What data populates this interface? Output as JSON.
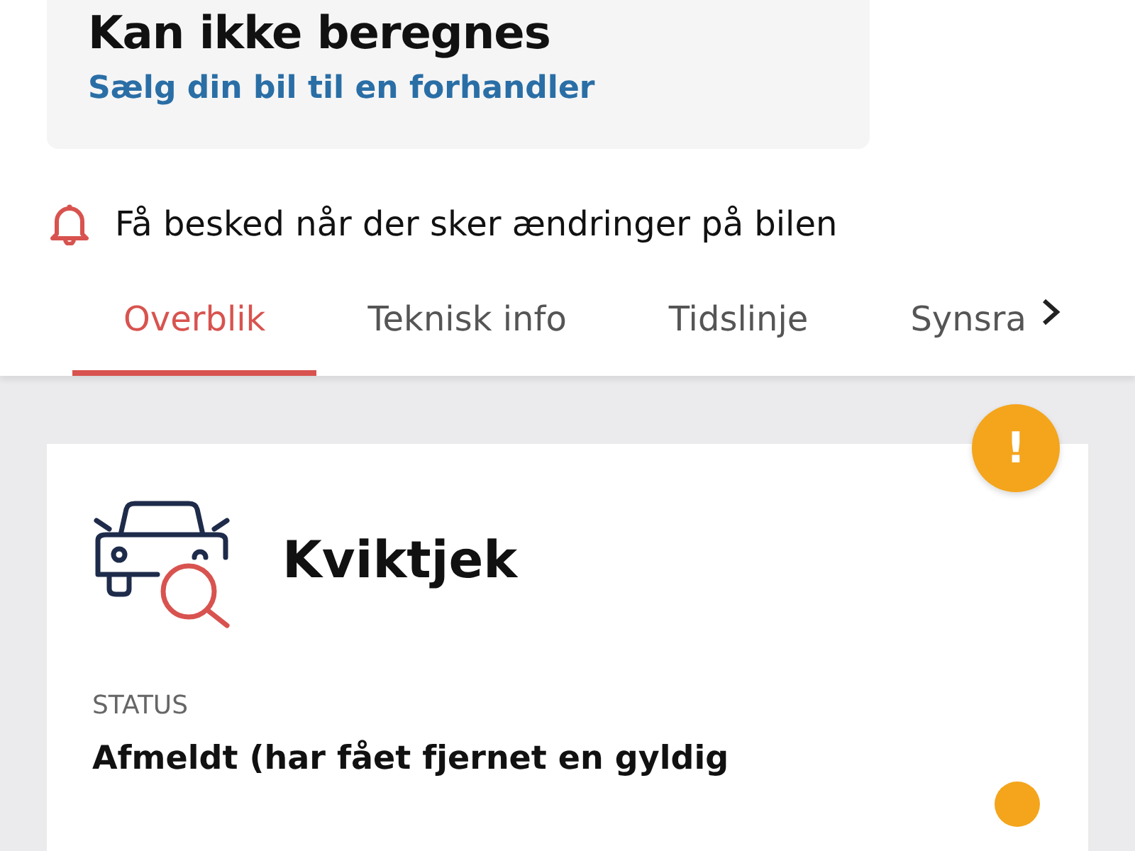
{
  "valuation": {
    "title": "Kan ikke beregnes",
    "link": "Sælg din bil til en forhandler"
  },
  "notify": {
    "label": "Få besked når der sker ændringer på bilen"
  },
  "tabs": [
    {
      "label": "Overblik",
      "selected": true
    },
    {
      "label": "Teknisk info",
      "selected": false
    },
    {
      "label": "Tidslinje",
      "selected": false
    },
    {
      "label": "Synsra",
      "selected": false
    }
  ],
  "quickcheck": {
    "title": "Kviktjek",
    "status_label": "STATUS",
    "status_value": "Afmeldt (har fået fjernet en gyldig",
    "badge": "!"
  }
}
